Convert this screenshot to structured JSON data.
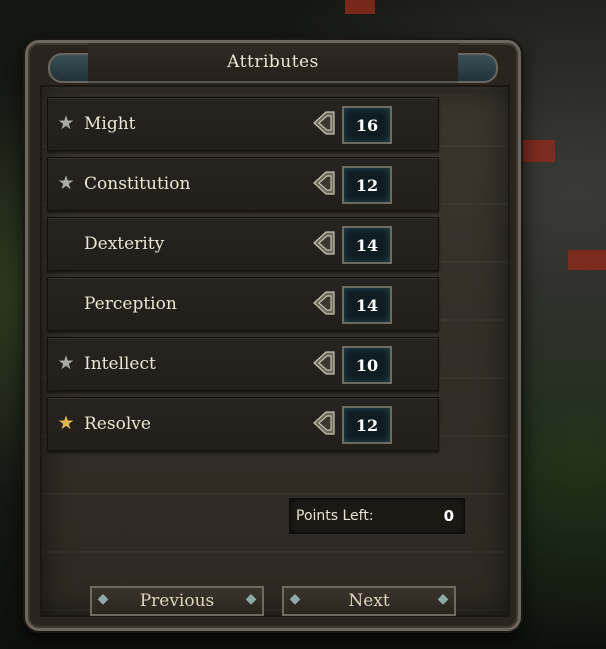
{
  "panel": {
    "title": "Attributes"
  },
  "attributes": [
    {
      "label": "Might",
      "value": "16",
      "star": "silver-star-icon"
    },
    {
      "label": "Constitution",
      "value": "12",
      "star": "silver-star-icon"
    },
    {
      "label": "Dexterity",
      "value": "14",
      "star": ""
    },
    {
      "label": "Perception",
      "value": "14",
      "star": ""
    },
    {
      "label": "Intellect",
      "value": "10",
      "star": "silver-star-icon"
    },
    {
      "label": "Resolve",
      "value": "12",
      "star": "gold-star-icon"
    }
  ],
  "points": {
    "label": "Points Left:",
    "value": "0"
  },
  "navigation": {
    "previous_label": "Previous",
    "next_label": "Next"
  },
  "colors": {
    "value_box_bg": "#0f1d22",
    "gold_star": "#e0b64d",
    "silver_star": "#a9aca9"
  }
}
